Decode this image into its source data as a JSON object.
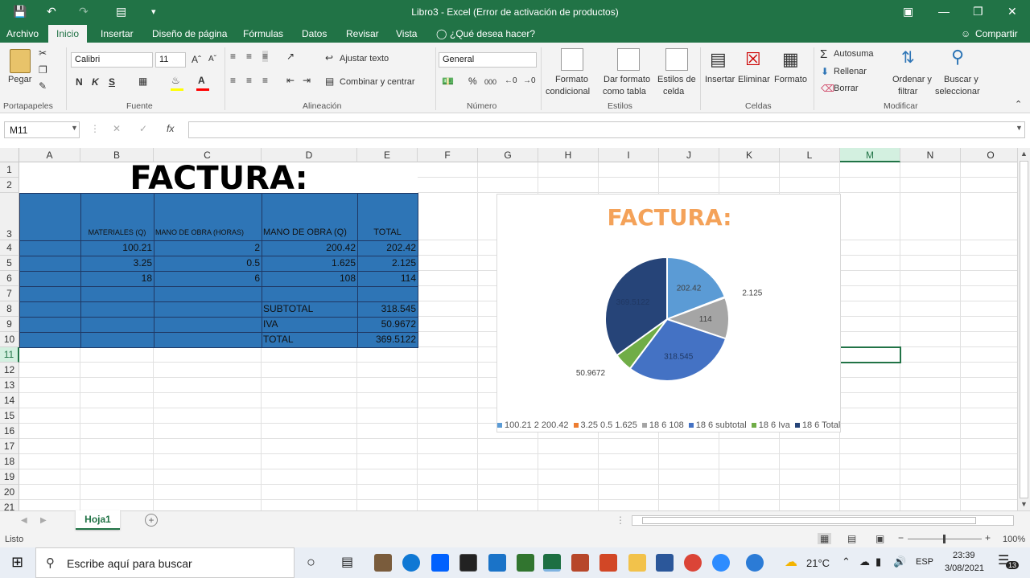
{
  "window": {
    "title": "Libro3  -  Excel (Error de activación de productos)"
  },
  "tabs": {
    "archivo": "Archivo",
    "inicio": "Inicio",
    "insertar": "Insertar",
    "diseno": "Diseño de página",
    "formulas": "Fórmulas",
    "datos": "Datos",
    "revisar": "Revisar",
    "vista": "Vista",
    "tell_me": "¿Qué desea hacer?",
    "share": "Compartir"
  },
  "ribbon": {
    "clipboard": {
      "paste": "Pegar",
      "group": "Portapapeles"
    },
    "font": {
      "name": "Calibri",
      "size": "11",
      "bold": "N",
      "italic": "K",
      "underline": "S",
      "group": "Fuente"
    },
    "alignment": {
      "wrap": "Ajustar texto",
      "merge": "Combinar y centrar",
      "group": "Alineación"
    },
    "number": {
      "format": "General",
      "percent": "%",
      "thousands": "000",
      "group": "Número"
    },
    "styles": {
      "conditional_1": "Formato",
      "conditional_2": "condicional",
      "table_1": "Dar formato",
      "table_2": "como tabla",
      "cell_1": "Estilos de",
      "cell_2": "celda",
      "group": "Estilos"
    },
    "cells": {
      "insert": "Insertar",
      "delete": "Eliminar",
      "format": "Formato",
      "group": "Celdas"
    },
    "editing": {
      "autosum": "Autosuma",
      "fill": "Rellenar",
      "clear": "Borrar",
      "sort_1": "Ordenar y",
      "sort_2": "filtrar",
      "find_1": "Buscar y",
      "find_2": "seleccionar",
      "group": "Modificar"
    }
  },
  "formula_bar": {
    "name_box": "M11",
    "fx": "fx",
    "value": ""
  },
  "columns": [
    "A",
    "B",
    "C",
    "D",
    "E",
    "F",
    "G",
    "H",
    "I",
    "J",
    "K",
    "L",
    "M",
    "N",
    "O"
  ],
  "rows": [
    "1",
    "2",
    "3",
    "4",
    "5",
    "6",
    "7",
    "8",
    "9",
    "10",
    "11",
    "12",
    "13",
    "14",
    "15",
    "16",
    "17",
    "18",
    "19",
    "20",
    "21"
  ],
  "sheet": {
    "title": "FACTURA:",
    "headers": {
      "b": "MATERIALES (Q)",
      "c": "MANO DE OBRA  (HORAS)",
      "d": "MANO DE OBRA (Q)",
      "e": "TOTAL"
    },
    "data": [
      {
        "b": "100.21",
        "c": "2",
        "d": "200.42",
        "e": "202.42"
      },
      {
        "b": "3.25",
        "c": "0.5",
        "d": "1.625",
        "e": "2.125"
      },
      {
        "b": "18",
        "c": "6",
        "d": "108",
        "e": "114"
      }
    ],
    "subtotal_label": "SUBTOTAL",
    "subtotal": "318.545",
    "iva_label": "IVA",
    "iva": "50.9672",
    "total_label": "TOTAL",
    "total": "369.5122"
  },
  "chart_data": {
    "type": "pie",
    "title": "FACTURA:",
    "slices": [
      {
        "label": "100.21 2 200.42",
        "value": 202.42,
        "data_label": "202.42",
        "color": "#5b9bd5"
      },
      {
        "label": "3.25 0.5 1.625",
        "value": 2.125,
        "data_label": "2.125",
        "color": "#ed7d31"
      },
      {
        "label": "18 6 108",
        "value": 114,
        "data_label": "114",
        "color": "#a5a5a5"
      },
      {
        "label": "18 6 subtotal",
        "value": 318.545,
        "data_label": "318.545",
        "color": "#4472c4"
      },
      {
        "label": "18 6 Iva",
        "value": 50.9672,
        "data_label": "50.9672",
        "color": "#70ad47"
      },
      {
        "label": "18 6 Total",
        "value": 369.5122,
        "data_label": "369.5122",
        "color": "#264478"
      }
    ],
    "legend_position": "bottom"
  },
  "sheet_tabs": {
    "active": "Hoja1"
  },
  "status": {
    "mode": "Listo",
    "zoom": "100%"
  },
  "taskbar": {
    "search": "Escribe aquí para buscar",
    "temp": "21°C",
    "lang": "ESP",
    "time": "23:39",
    "date": "3/08/2021",
    "notifications": "13"
  },
  "colors": {
    "excel_green": "#217346",
    "table_blue": "#2e75b6",
    "title_orange": "#f4a259"
  }
}
